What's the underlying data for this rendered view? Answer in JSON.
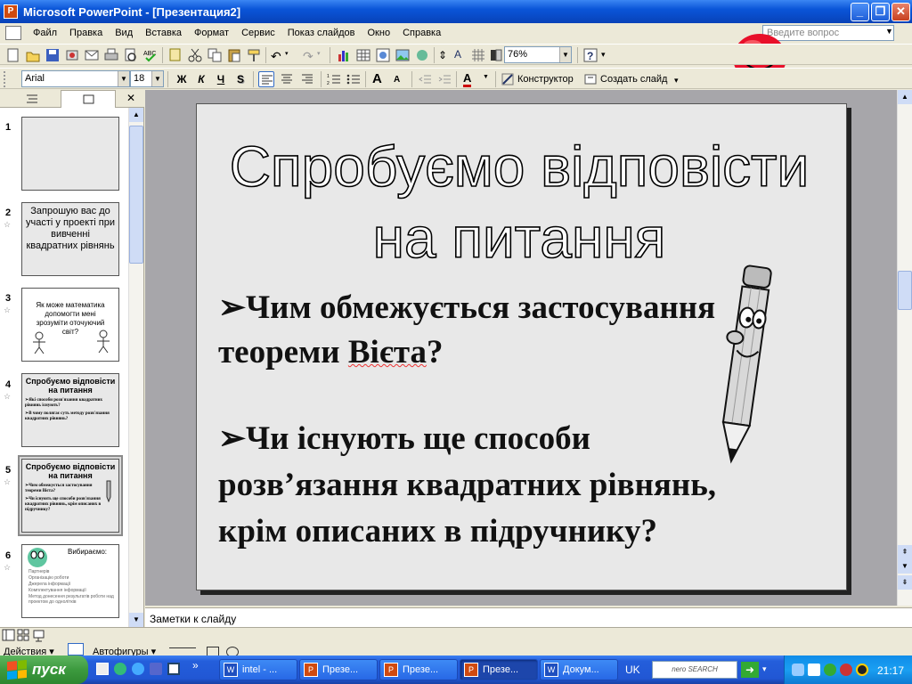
{
  "window": {
    "title": "Microsoft PowerPoint - [Презентация2]",
    "minimize": "_",
    "restore": "❐",
    "close": "✕"
  },
  "menu": [
    "Файл",
    "Правка",
    "Вид",
    "Вставка",
    "Формат",
    "Сервис",
    "Показ слайдов",
    "Окно",
    "Справка"
  ],
  "help": {
    "placeholder": "Введите вопрос"
  },
  "toolbar": {
    "zoom": "76%"
  },
  "format_toolbar": {
    "font": "Arial",
    "size": "18",
    "bold": "Ж",
    "italic": "К",
    "underline": "Ч",
    "shadow": "S",
    "designer": "Конструктор",
    "new_slide": "Создать слайд"
  },
  "slides_panel": {
    "thumbs": [
      {
        "num": "1",
        "text": ""
      },
      {
        "num": "2",
        "text": "Запрошую вас до участі у проекті при вивченні квадратних рівнянь"
      },
      {
        "num": "3",
        "text": "Як може математика допомогти мені зрозуміти оточуючий світ?"
      },
      {
        "num": "4",
        "title": "Спробуємо відповісти на питання",
        "lines": [
          "➢Які способи розв'язання квадратних рівнянь існують?",
          "➢В чому полягає суть методу розв'язання квадратних рівнянь?"
        ]
      },
      {
        "num": "5",
        "title": "Спробуємо відповісти на питання",
        "lines": [
          "➢Чим обмежується застосування теореми Вієта?",
          "➢Чи існують ще способи розв'язання квадратних рівнянь, крім описаних в підручнику?"
        ]
      },
      {
        "num": "6",
        "title": "Вибираємо:",
        "lines": [
          "Партнерів",
          "Організацію роботи",
          "Джерела інформації",
          "Комплектування інформації",
          "Метод донесення результатів роботи над проектом до однолітків"
        ]
      }
    ]
  },
  "slide": {
    "title_line1": "Спробуємо відповісти",
    "title_line2": "на питання",
    "bullet1_line1": "Чим обмежується застосування",
    "bullet1_line2_a": "теореми ",
    "bullet1_line2_b": "Вієта",
    "bullet1_line2_c": "?",
    "bullet2_line1": "Чи існують ще способи",
    "bullet2_line2": "розв’язання квадратних рівнянь,",
    "bullet2_line3": "крім описаних в підручнику?",
    "bullet_glyph": "➢"
  },
  "notes": {
    "placeholder": "Заметки к слайду"
  },
  "drawbar": {
    "actions": "Действия ▾",
    "autoshapes": "Автофигуры ▾"
  },
  "taskbar": {
    "start": "пуск",
    "tasks": [
      {
        "label": "intel - ...",
        "type": "w"
      },
      {
        "label": "Презе...",
        "type": "p"
      },
      {
        "label": "Презе...",
        "type": "p"
      },
      {
        "label": "Презе...",
        "type": "p",
        "active": true
      },
      {
        "label": "Докум...",
        "type": "w"
      }
    ],
    "lang": "UK",
    "nero": "nero SEARCH",
    "time": "21:17"
  }
}
